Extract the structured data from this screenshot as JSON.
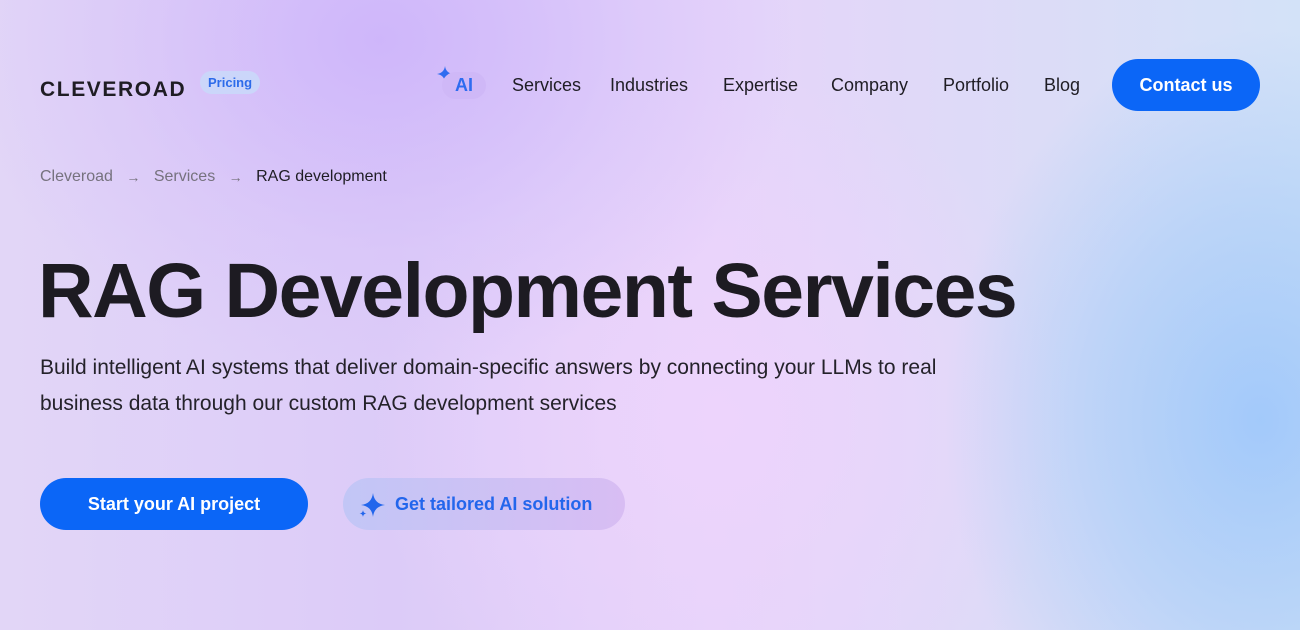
{
  "header": {
    "logo": "CLEVEROAD",
    "pricing_badge": "Pricing",
    "nav": {
      "ai": "AI",
      "items": [
        "Services",
        "Industries",
        "Expertise",
        "Company",
        "Portfolio",
        "Blog"
      ]
    },
    "contact_button": "Contact us"
  },
  "breadcrumb": {
    "items": [
      "Cleveroad",
      "Services"
    ],
    "current": "RAG development"
  },
  "hero": {
    "title": "RAG Development Services",
    "description": "Build intelligent AI systems that deliver domain-specific answers by connecting your LLMs to real business data through our custom RAG development services",
    "primary_button": "Start your AI project",
    "secondary_button": "Get tailored AI solution"
  },
  "icons": {
    "ai_spark": "sparkle-icon",
    "breadcrumb_separator": "arrow-right-icon",
    "secondary_button_icon": "sparkle-icon"
  },
  "colors": {
    "accent": "#0b66f7",
    "badge_text": "#2d6bea",
    "text": "#1d1b22",
    "muted": "#76727e"
  }
}
